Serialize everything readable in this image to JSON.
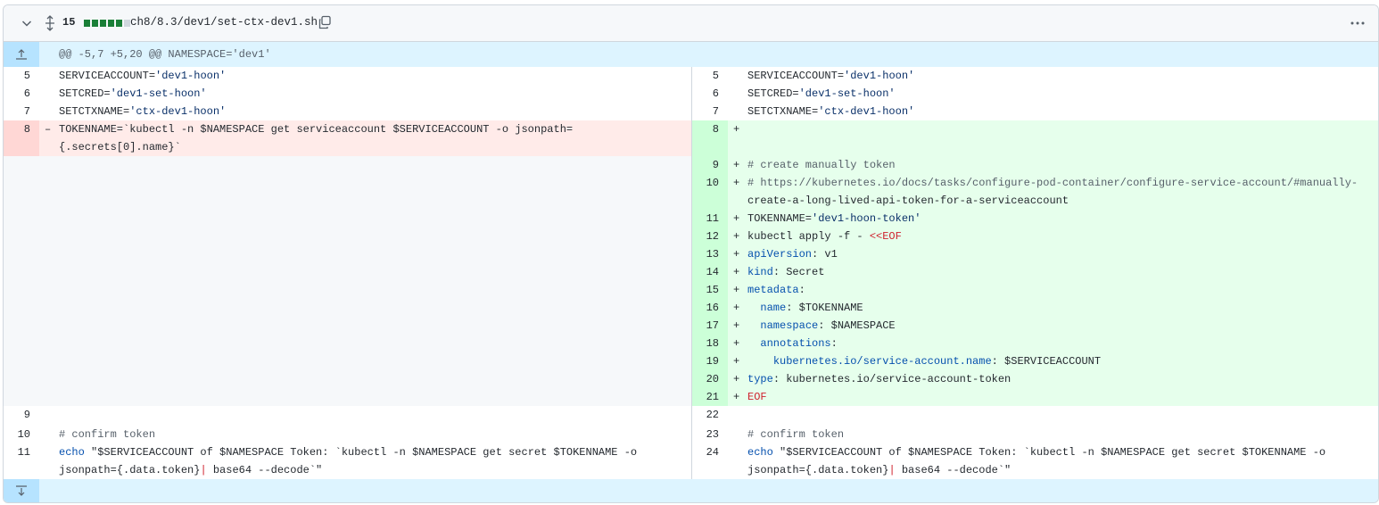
{
  "file": {
    "changes_count": "15",
    "path": "ch8/8.3/dev1/set-ctx-dev1.sh",
    "diffstat": [
      "#1a7f37",
      "#1a7f37",
      "#1a7f37",
      "#1a7f37",
      "#1a7f37",
      "#d0d7de"
    ],
    "hunk_header": "@@ -5,7 +5,20 @@ NAMESPACE='dev1'"
  },
  "icons": {
    "collapse": "chevron-down-icon",
    "expand_all": "unfold-icon",
    "copy": "copy-icon",
    "more": "kebab-horizontal-icon",
    "expand_up": "fold-up-icon",
    "expand_down": "fold-down-icon"
  },
  "left": {
    "rows": [
      {
        "n": "5",
        "sign": "",
        "text": "SERVICEACCOUNT='dev1-hoon'"
      },
      {
        "n": "6",
        "sign": "",
        "text": "SETCRED='dev1-set-hoon'"
      },
      {
        "n": "7",
        "sign": "",
        "text": "SETCTXNAME='ctx-dev1-hoon'"
      },
      {
        "n": "8",
        "sign": "-",
        "text": "TOKENNAME=`kubectl -n $NAMESPACE get serviceaccount $SERVICEACCOUNT -o jsonpath=\n{.secrets[0].name}`"
      },
      {
        "n": "9",
        "sign": "",
        "text": ""
      },
      {
        "n": "10",
        "sign": "",
        "text": "# confirm token"
      },
      {
        "n": "11",
        "sign": "",
        "text": "echo \"$SERVICEACCOUNT of $NAMESPACE Token: `kubectl -n $NAMESPACE get secret $TOKENNAME -o\njsonpath={.data.token}| base64 --decode`\""
      }
    ]
  },
  "right": {
    "rows": [
      {
        "n": "5",
        "sign": "",
        "text": "SERVICEACCOUNT='dev1-hoon'"
      },
      {
        "n": "6",
        "sign": "",
        "text": "SETCRED='dev1-set-hoon'"
      },
      {
        "n": "7",
        "sign": "",
        "text": "SETCTXNAME='ctx-dev1-hoon'"
      },
      {
        "n": "8",
        "sign": "+",
        "text": ""
      },
      {
        "n": "9",
        "sign": "+",
        "text": "# create manually token"
      },
      {
        "n": "10",
        "sign": "+",
        "text": "# https://kubernetes.io/docs/tasks/configure-pod-container/configure-service-account/#manually-\ncreate-a-long-lived-api-token-for-a-serviceaccount"
      },
      {
        "n": "11",
        "sign": "+",
        "text": "TOKENNAME='dev1-hoon-token'"
      },
      {
        "n": "12",
        "sign": "+",
        "text": "kubectl apply -f - <<EOF"
      },
      {
        "n": "13",
        "sign": "+",
        "text": "apiVersion: v1"
      },
      {
        "n": "14",
        "sign": "+",
        "text": "kind: Secret"
      },
      {
        "n": "15",
        "sign": "+",
        "text": "metadata:"
      },
      {
        "n": "16",
        "sign": "+",
        "text": "  name: $TOKENNAME"
      },
      {
        "n": "17",
        "sign": "+",
        "text": "  namespace: $NAMESPACE"
      },
      {
        "n": "18",
        "sign": "+",
        "text": "  annotations:"
      },
      {
        "n": "19",
        "sign": "+",
        "text": "    kubernetes.io/service-account.name: $SERVICEACCOUNT"
      },
      {
        "n": "20",
        "sign": "+",
        "text": "type: kubernetes.io/service-account-token"
      },
      {
        "n": "21",
        "sign": "+",
        "text": "EOF"
      },
      {
        "n": "22",
        "sign": "",
        "text": ""
      },
      {
        "n": "23",
        "sign": "",
        "text": "# confirm token"
      },
      {
        "n": "24",
        "sign": "",
        "text": "echo \"$SERVICEACCOUNT of $NAMESPACE Token: `kubectl -n $NAMESPACE get secret $TOKENNAME -o\njsonpath={.data.token}| base64 --decode`\""
      }
    ]
  }
}
